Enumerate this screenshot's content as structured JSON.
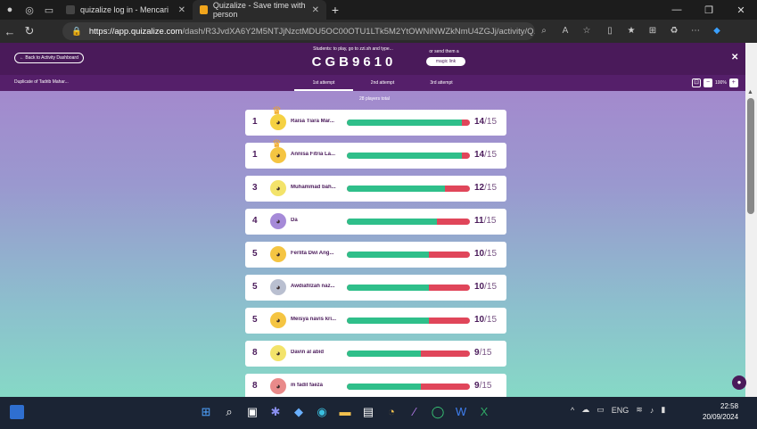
{
  "browser": {
    "tabs": [
      {
        "title": "quizalize log in - Mencari",
        "active": false
      },
      {
        "title": "Quizalize - Save time with person",
        "active": true
      }
    ],
    "url_domain": "https://app.quizalize.com",
    "url_path": "/dash/R3JvdXA6Y2M5NTJjNzctMDU5OC00OTU1LTk5M2YtOWNiNWZkNmU4ZGJj/activity/Q..."
  },
  "app": {
    "back_label": "← Back to Activity Dashboard",
    "join_text": "Students: to play, go to zzi.sh and type...",
    "join_code": "CGB9610",
    "send_text": "or send them a",
    "magic_link_label": "magic link",
    "activity_title": "Duplicate of Tadrib Mahar...",
    "attempts": [
      "1st attempt",
      "2nd attempt",
      "3rd attempt"
    ],
    "zoom_level": "100%",
    "players_total": "28 players total",
    "accent": "#4a1a5a",
    "correct_color": "#2fbf8a",
    "wrong_color": "#e0465a"
  },
  "leaderboard": [
    {
      "rank": "1",
      "name": "Raisa Tiara Mar...",
      "score": "14",
      "total": "/15",
      "fraction": 0.933,
      "crown": true,
      "avatar_color": "#f5d142",
      "avatar_icon": "monster-avatar-icon"
    },
    {
      "rank": "1",
      "name": "Annisa Fitria La...",
      "score": "14",
      "total": "/15",
      "fraction": 0.933,
      "crown": true,
      "avatar_color": "#f5c542",
      "avatar_icon": "monster-avatar-icon"
    },
    {
      "rank": "3",
      "name": "Muhammad bah...",
      "score": "12",
      "total": "/15",
      "fraction": 0.8,
      "crown": false,
      "avatar_color": "#f3e36a",
      "avatar_icon": "monster-avatar-icon"
    },
    {
      "rank": "4",
      "name": "Da",
      "score": "11",
      "total": "/15",
      "fraction": 0.733,
      "crown": false,
      "avatar_color": "#a58ad8",
      "avatar_icon": "monster-avatar-icon"
    },
    {
      "rank": "5",
      "name": "Ferlita Dwi Ang...",
      "score": "10",
      "total": "/15",
      "fraction": 0.667,
      "crown": false,
      "avatar_color": "#f5c542",
      "avatar_icon": "monster-avatar-icon"
    },
    {
      "rank": "5",
      "name": "Awdiafilzah naz...",
      "score": "10",
      "total": "/15",
      "fraction": 0.667,
      "crown": false,
      "avatar_color": "#b9bfd0",
      "avatar_icon": "monster-avatar-icon"
    },
    {
      "rank": "5",
      "name": "Meisya navis kri...",
      "score": "10",
      "total": "/15",
      "fraction": 0.667,
      "crown": false,
      "avatar_color": "#f5c542",
      "avatar_icon": "monster-avatar-icon"
    },
    {
      "rank": "8",
      "name": "Davin al abid",
      "score": "9",
      "total": "/15",
      "fraction": 0.6,
      "crown": false,
      "avatar_color": "#f3e36a",
      "avatar_icon": "monster-avatar-icon"
    },
    {
      "rank": "8",
      "name": "m fadil faeza",
      "score": "9",
      "total": "/15",
      "fraction": 0.6,
      "crown": false,
      "avatar_color": "#e98a8a",
      "avatar_icon": "monster-avatar-icon"
    }
  ],
  "taskbar": {
    "lang": "ENG",
    "time": "22:58",
    "date": "20/09/2024"
  }
}
